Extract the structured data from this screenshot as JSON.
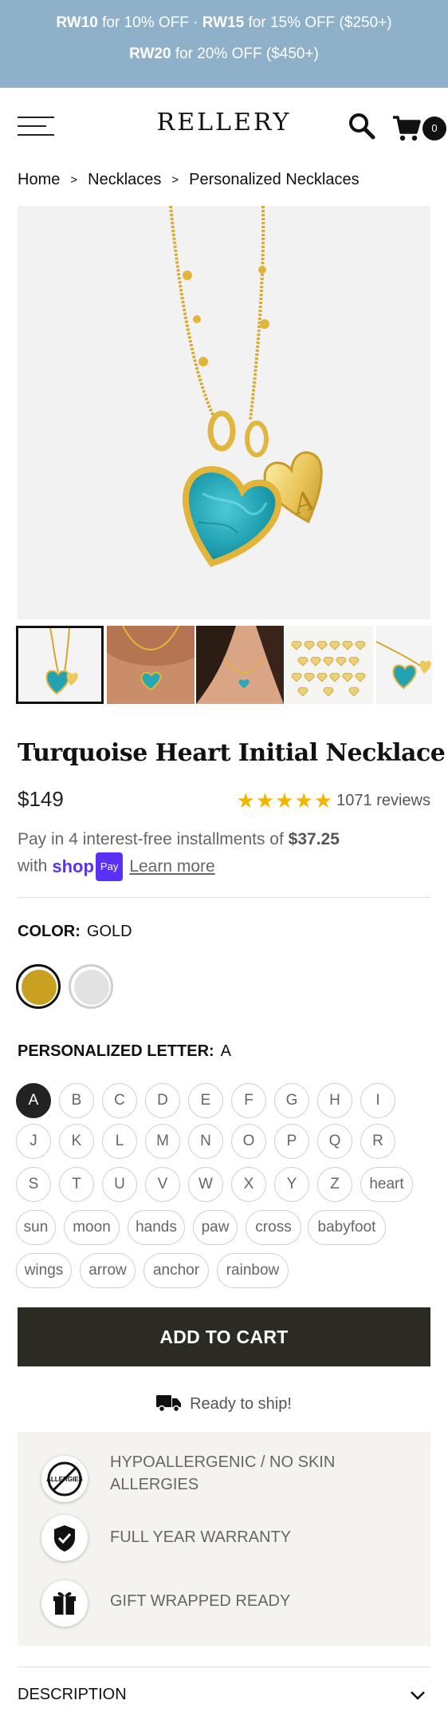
{
  "promo": {
    "line1_code1": "RW10",
    "line1_text1": " for 10% OFF · ",
    "line1_code2": "RW15",
    "line1_text2": " for 15% OFF ($250+)",
    "line2_code": "RW20",
    "line2_text": " for 20% OFF ($450+)",
    "background": "#8fb0c9"
  },
  "header": {
    "logo": "RELLERY",
    "cart_count": "0",
    "icons": [
      "menu-icon",
      "search-icon",
      "cart-icon"
    ]
  },
  "breadcrumb": [
    "Home",
    "Necklaces",
    "Personalized Necklaces"
  ],
  "breadcrumb_separator": ">",
  "gallery": {
    "thumbnails": [
      "turquoise-heart-product",
      "model-wearing-closeup",
      "model-wearing-portrait",
      "gold-heart-charms-grid",
      "necklace-detail"
    ],
    "active_index": 0
  },
  "product": {
    "title": "Turquoise Heart Initial Necklace",
    "price": "$149",
    "stars": "★★★★★",
    "rating_value": 5,
    "reviews": "1071 reviews"
  },
  "installments": {
    "text_before": "Pay in 4 interest-free installments of ",
    "amount": "$37.25",
    "text_with": "with",
    "shop_word": "shop",
    "shop_pay": "Pay",
    "learn_more": "Learn more",
    "brand_color": "#5a31f4"
  },
  "color_option": {
    "label": "COLOR:",
    "selected": "GOLD",
    "swatches": [
      {
        "name": "Gold",
        "color": "#c9a020"
      },
      {
        "name": "Silver",
        "color": "#e2e2e2"
      }
    ]
  },
  "letter_option": {
    "label": "PERSONALIZED LETTER:",
    "selected": "A",
    "row1": [
      "A",
      "B",
      "C",
      "D",
      "E",
      "F",
      "G",
      "H",
      "I"
    ],
    "row2": [
      "J",
      "K",
      "L",
      "M",
      "N",
      "O",
      "P",
      "Q",
      "R"
    ],
    "row3": [
      "S",
      "T",
      "U",
      "V",
      "W",
      "X",
      "Y",
      "Z",
      "heart"
    ],
    "row4": [
      "sun",
      "moon",
      "hands",
      "paw",
      "cross",
      "babyfoot"
    ],
    "row5": [
      "wings",
      "arrow",
      "anchor",
      "rainbow"
    ]
  },
  "add_to_cart": "ADD TO CART",
  "shipping": "Ready to ship!",
  "features": [
    {
      "icon": "allergies-icon",
      "icon_text": "ALLERGIES",
      "line1": "HYPOALLERGENIC / NO SKIN",
      "line2": "ALLERGIES"
    },
    {
      "icon": "shield-check-icon",
      "line1": "FULL YEAR WARRANTY"
    },
    {
      "icon": "gift-icon",
      "line1": "GIFT WRAPPED READY"
    }
  ],
  "description": {
    "label": "DESCRIPTION",
    "icon": "chevron-down-icon"
  },
  "colors": {
    "button_dark": "#2b2b24",
    "star": "#f2b600",
    "feature_bg": "#f4f3ef"
  }
}
